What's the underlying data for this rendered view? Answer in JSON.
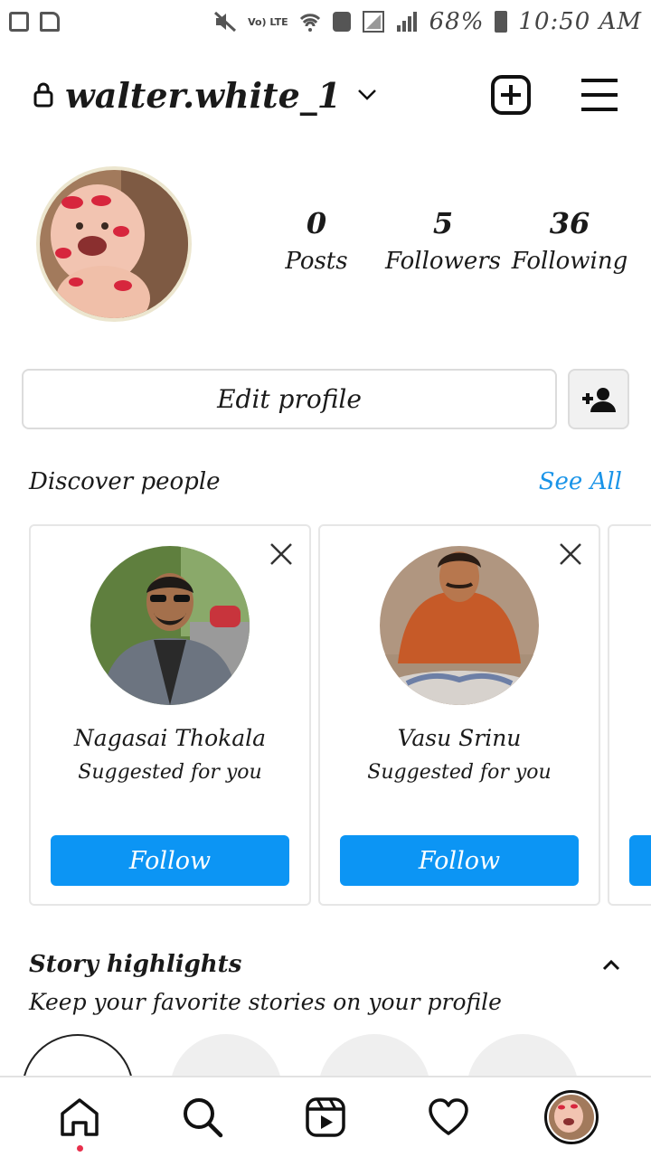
{
  "status_bar": {
    "lte_label": "Vo) LTE",
    "battery": "68%",
    "time": "10:50 AM"
  },
  "header": {
    "username": "walter.white_1"
  },
  "profile": {
    "stats": [
      {
        "value": "0",
        "label": "Posts"
      },
      {
        "value": "5",
        "label": "Followers"
      },
      {
        "value": "36",
        "label": "Following"
      }
    ],
    "edit_profile_label": "Edit profile"
  },
  "discover": {
    "title": "Discover people",
    "see_all": "See All",
    "cards": [
      {
        "name": "Nagasai Thokala",
        "subtitle": "Suggested for you",
        "button": "Follow"
      },
      {
        "name": "Vasu Srinu",
        "subtitle": "Suggested for you",
        "button": "Follow"
      }
    ]
  },
  "highlights": {
    "title": "Story highlights",
    "subtitle": "Keep your favorite stories on your profile"
  },
  "colors": {
    "accent": "#0c95f4",
    "link": "#1a94e8",
    "notification_dot": "#e8304c"
  }
}
